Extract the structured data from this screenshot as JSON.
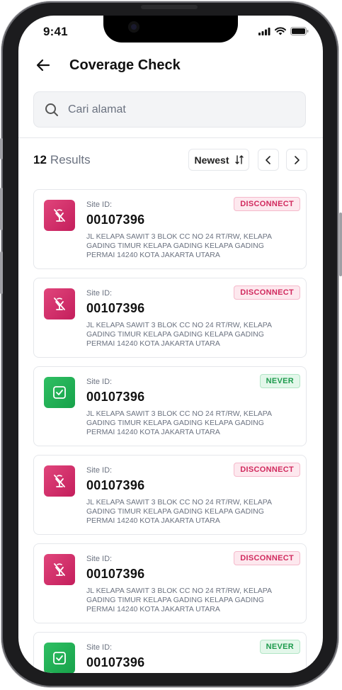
{
  "status_bar": {
    "time": "9:41"
  },
  "header": {
    "title": "Coverage Check"
  },
  "search": {
    "placeholder": "Cari alamat"
  },
  "results": {
    "count": "12",
    "label": "Results"
  },
  "sort": {
    "label": "Newest"
  },
  "colors": {
    "disconnect": "#d12a5e",
    "never": "#1c9a4c"
  },
  "sites": [
    {
      "site_label": "Site ID:",
      "site_id": "00107396",
      "status": "DISCONNECT",
      "icon": "no-signal-icon",
      "address": "JL KELAPA SAWIT 3 BLOK CC NO 24 RT/RW, KELAPA GADING TIMUR KELAPA GADING KELAPA GADING PERMAI 14240 KOTA JAKARTA UTARA"
    },
    {
      "site_label": "Site ID:",
      "site_id": "00107396",
      "status": "DISCONNECT",
      "icon": "no-signal-icon",
      "address": "JL KELAPA SAWIT 3 BLOK CC NO 24 RT/RW, KELAPA GADING TIMUR KELAPA GADING KELAPA GADING PERMAI 14240 KOTA JAKARTA UTARA"
    },
    {
      "site_label": "Site ID:",
      "site_id": "00107396",
      "status": "NEVER",
      "icon": "check-icon",
      "address": "JL KELAPA SAWIT 3 BLOK CC NO 24 RT/RW, KELAPA GADING TIMUR KELAPA GADING KELAPA GADING PERMAI 14240 KOTA JAKARTA UTARA"
    },
    {
      "site_label": "Site ID:",
      "site_id": "00107396",
      "status": "DISCONNECT",
      "icon": "no-signal-icon",
      "address": "JL KELAPA SAWIT 3 BLOK CC NO 24 RT/RW, KELAPA GADING TIMUR KELAPA GADING KELAPA GADING PERMAI 14240 KOTA JAKARTA UTARA"
    },
    {
      "site_label": "Site ID:",
      "site_id": "00107396",
      "status": "DISCONNECT",
      "icon": "no-signal-icon",
      "address": "JL KELAPA SAWIT 3 BLOK CC NO 24 RT/RW, KELAPA GADING TIMUR KELAPA GADING KELAPA GADING PERMAI 14240 KOTA JAKARTA UTARA"
    },
    {
      "site_label": "Site ID:",
      "site_id": "00107396",
      "status": "NEVER",
      "icon": "check-icon",
      "address": ""
    }
  ]
}
